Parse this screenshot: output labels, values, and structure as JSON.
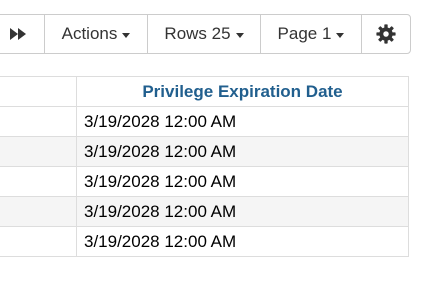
{
  "toolbar": {
    "next_icon": "fast-forward-icon",
    "actions_label": "Actions",
    "rows_label": "Rows 25",
    "page_label": "Page 1",
    "settings_icon": "gear-icon"
  },
  "table": {
    "header": "Privilege Expiration Date",
    "rows": [
      "3/19/2028 12:00 AM",
      "3/19/2028 12:00 AM",
      "3/19/2028 12:00 AM",
      "3/19/2028 12:00 AM",
      "3/19/2028 12:00 AM"
    ]
  },
  "colors": {
    "header_text": "#215f8e",
    "stripe": "#f5f5f5",
    "border": "#dddddd"
  }
}
